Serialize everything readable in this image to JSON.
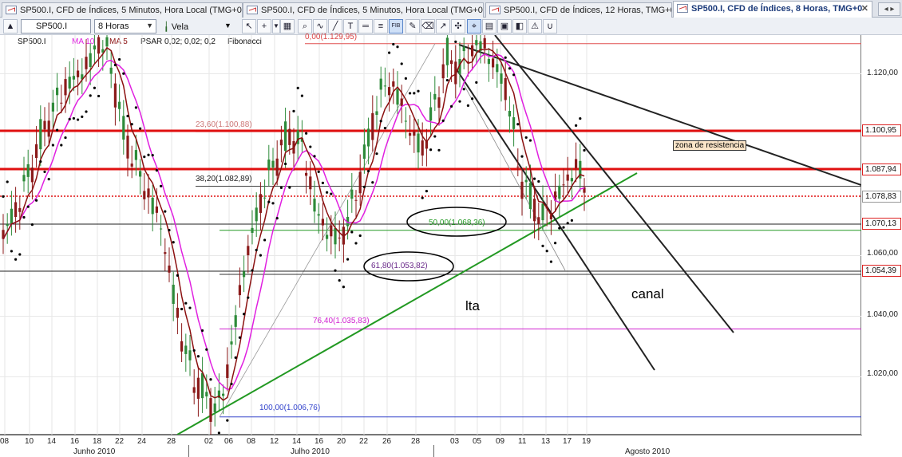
{
  "tabs": [
    {
      "label": "SP500.I, CFD de Índices, 5 Minutos, Hora Local (TMG+0)"
    },
    {
      "label": "SP500.I, CFD de Índices, 5 Minutos, Hora Local (TMG+0)"
    },
    {
      "label": "SP500.I, CFD de Índices, 12 Horas, TMG+0"
    },
    {
      "label": "SP500.I, CFD de Índices, 8 Horas, TMG+0"
    }
  ],
  "toolbar": {
    "symbol": "SP500.I",
    "timeframe": "8 Horas",
    "chart_type": "Vela",
    "fib_button": "FIB"
  },
  "legend": {
    "symbol": "SP500.I",
    "ma10": "MA 10",
    "ma5": "MA 5",
    "psar": "PSAR 0,02; 0,02; 0,2",
    "fibonacci": "Fibonacci"
  },
  "colors": {
    "red_line": "#e01010",
    "ma_fast": "#8b1010",
    "ma_slow": "#e020e0",
    "trend_green": "#229922",
    "up_candle": "#2e8b3a",
    "down_candle": "#8b1a1a"
  },
  "fib_labels": {
    "f0": "0,00(1.129,95)",
    "f236": "23,60(1.100,88)",
    "f382": "38,20(1.082,89)",
    "f50": "50,00(1.068,36)",
    "f618": "61,80(1.053,82)",
    "f764": "76,40(1.035,83)",
    "f100": "100,00(1.006,76)"
  },
  "annotations": {
    "lta": "lta",
    "canal": "canal",
    "zona": "zona de resistencia"
  },
  "yaxis": {
    "ticks": [
      "1.120,00",
      "1.060,00",
      "1.040,00",
      "1.020,00"
    ],
    "boxes": [
      "1.100,95",
      "1.087,94",
      "1.078,83",
      "1.070,13",
      "1.054,39"
    ]
  },
  "xaxis": {
    "days": [
      "08",
      "10",
      "14",
      "16",
      "18",
      "22",
      "24",
      "28",
      "02",
      "06",
      "08",
      "12",
      "14",
      "16",
      "20",
      "22",
      "26",
      "28",
      "03",
      "05",
      "09",
      "11",
      "13",
      "17",
      "19"
    ],
    "months": [
      "Junho 2010",
      "Julho 2010",
      "Agosto 2010"
    ]
  }
}
